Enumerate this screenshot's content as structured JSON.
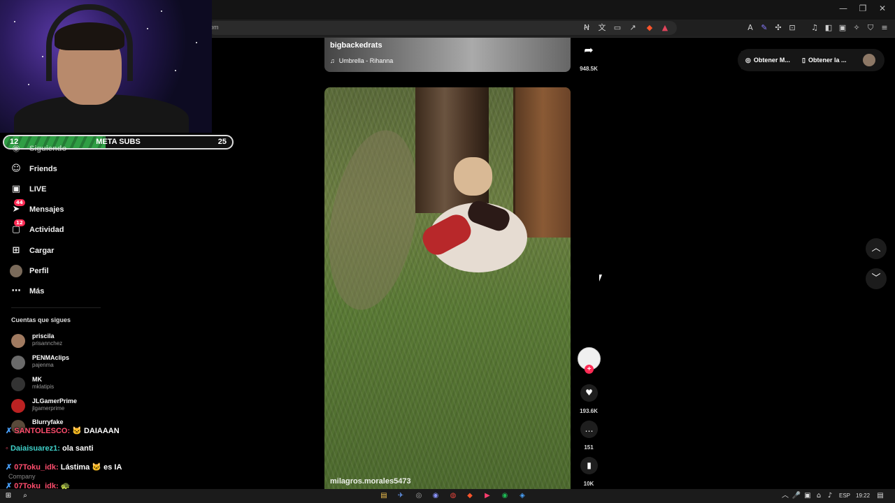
{
  "browser": {
    "url_suffix": "om",
    "window_buttons": [
      "—",
      "❐",
      "✕"
    ]
  },
  "overlay": {
    "meta": {
      "left": "12",
      "title": "META SUBS",
      "right": "25"
    }
  },
  "sidebar": {
    "items": [
      {
        "label": "Siguiendo",
        "icon": "following-icon"
      },
      {
        "label": "Friends",
        "icon": "friends-icon"
      },
      {
        "label": "LIVE",
        "icon": "live-icon"
      },
      {
        "label": "Mensajes",
        "icon": "messages-icon",
        "badge": "44"
      },
      {
        "label": "Actividad",
        "icon": "activity-icon",
        "badge": "12"
      },
      {
        "label": "Cargar",
        "icon": "upload-icon"
      },
      {
        "label": "Perfil",
        "icon": "profile-icon"
      },
      {
        "label": "Más",
        "icon": "more-icon"
      }
    ],
    "following_title": "Cuentas que sigues",
    "accounts": [
      {
        "name": "priscila",
        "user": "prisannchez"
      },
      {
        "name": "PENMAclips",
        "user": "pajenma"
      },
      {
        "name": "MK",
        "user": "mklatipis"
      },
      {
        "name": "JLGamerPrime",
        "user": "jlgamerprime"
      },
      {
        "name": "Blurryfake",
        "user": ""
      }
    ]
  },
  "chat": [
    {
      "user": "SANTOLESCO:",
      "message": "DAIAAAN",
      "color": "#ff4d6d"
    },
    {
      "user": "Daiaisuarez1:",
      "message": "ola santi",
      "color": "#3fd0c9"
    },
    {
      "user": "07Toku_idk:",
      "message": "Lástima",
      "message2": "es IA",
      "color": "#ff4d6d"
    },
    {
      "user": "07Toku_idk:",
      "message": "",
      "color": "#ff4d6d"
    }
  ],
  "chat_footer": "Company",
  "feed": {
    "prev": {
      "user": "bigbackedrats",
      "music": "Umbrella - Rihanna",
      "share_count": "948.5K"
    },
    "current": {
      "user": "milagros.morales5473",
      "likes": "193.6K",
      "comments": "151",
      "saves": "10K"
    }
  },
  "right_panel": {
    "pill1": "Obtener M...",
    "pill2": "Obtener la ..."
  },
  "taskbar": {
    "lang": "ESP",
    "time": "19:22"
  },
  "colors": {
    "accent": "#fe2c55",
    "background": "#000000"
  }
}
